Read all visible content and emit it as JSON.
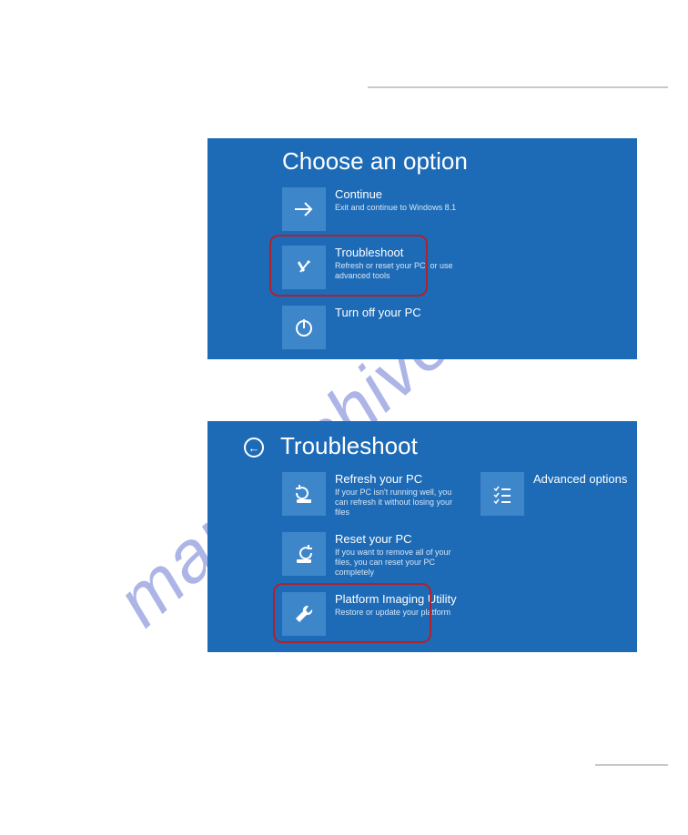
{
  "watermark": "manualshive.com",
  "panel1": {
    "heading": "Choose an option",
    "tiles": [
      {
        "title": "Continue",
        "desc": "Exit and continue to Windows 8.1"
      },
      {
        "title": "Troubleshoot",
        "desc": "Refresh or reset your PC, or use advanced tools"
      },
      {
        "title": "Turn off your PC",
        "desc": ""
      }
    ]
  },
  "panel2": {
    "heading": "Troubleshoot",
    "tiles": [
      {
        "title": "Refresh your PC",
        "desc": "If your PC isn't running well, you can refresh it without losing your files"
      },
      {
        "title": "Reset your PC",
        "desc": "If you want to remove all of your files, you can reset your PC completely"
      },
      {
        "title": "Platform Imaging Utility",
        "desc": "Restore or update your platform"
      },
      {
        "title": "Advanced options",
        "desc": ""
      }
    ],
    "back_glyph": "←"
  }
}
